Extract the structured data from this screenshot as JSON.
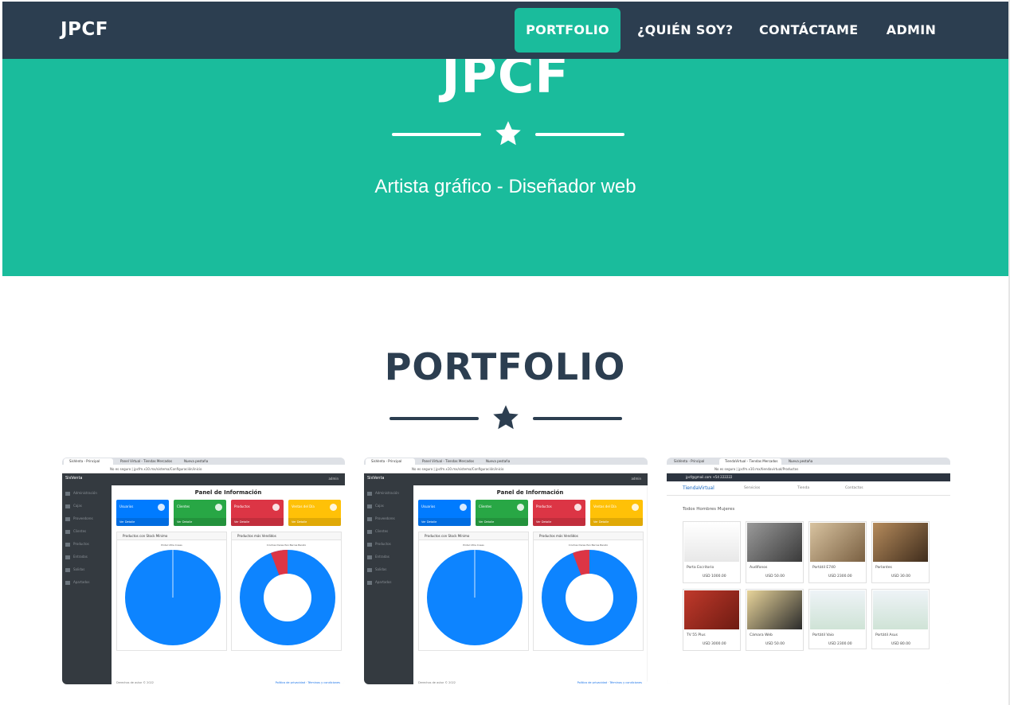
{
  "navbar": {
    "brand": "JPCF",
    "links": [
      {
        "label": "PORTFOLIO",
        "active": true
      },
      {
        "label": "¿QUIÉN SOY?",
        "active": false
      },
      {
        "label": "CONTÁCTAME",
        "active": false
      },
      {
        "label": "ADMIN",
        "active": false
      }
    ]
  },
  "hero": {
    "title": "JPCF",
    "subtitle": "Artista gráfico - Diseñador web"
  },
  "portfolio": {
    "title": "PORTFOLIO",
    "items": [
      {
        "type": "dashboard",
        "tabs": [
          "SisVenta - Principal",
          "Panel Virtual - Tiendas Mercados",
          "Nueva pestaña"
        ],
        "url": "No es seguro | jpcfm.x10.mx/sistema/Configuración/inicio",
        "app_name": "SisVenta",
        "user": "admin",
        "menu": [
          "Administración",
          "Cajas",
          "Proveedores",
          "Clientes",
          "Productos",
          "Entradas",
          "Salidas",
          "Apartados"
        ],
        "heading": "Panel de Información",
        "boxes": [
          {
            "label": "Usuarios",
            "footer": "Ver Detalle",
            "color": "#007bff"
          },
          {
            "label": "Clientes",
            "footer": "Ver Detalle",
            "color": "#28a745"
          },
          {
            "label": "Productos",
            "footer": "Ver Detalle",
            "color": "#dc3545"
          },
          {
            "label": "Ventas del Día",
            "footer": "Ver Detalle",
            "color": "#ffc107"
          }
        ],
        "panels": [
          {
            "title": "Productos con Stock Mínimo",
            "legend": "Pintal Ultra    Cosas"
          },
          {
            "title": "Productos más Vendidos",
            "legend": "Cinchas Dares    Pan Barras Barato"
          }
        ],
        "footer_left": "Derechos de autor © 2022",
        "footer_right": "Política de privacidad · Términos y condiciones"
      },
      {
        "type": "dashboard",
        "tabs": [
          "SisVenta - Principal",
          "Panel Virtual - Tiendas Mercados",
          "Nueva pestaña"
        ],
        "url": "No es seguro | jpcfm.x10.mx/sistema/Configuración/inicio",
        "app_name": "SisVenta",
        "user": "admin",
        "menu": [
          "Administración",
          "Cajas",
          "Proveedores",
          "Clientes",
          "Productos",
          "Entradas",
          "Salidas",
          "Apartados"
        ],
        "heading": "Panel de Información",
        "boxes": [
          {
            "label": "Usuarios",
            "footer": "Ver Detalle",
            "color": "#007bff"
          },
          {
            "label": "Clientes",
            "footer": "Ver Detalle",
            "color": "#28a745"
          },
          {
            "label": "Productos",
            "footer": "Ver Detalle",
            "color": "#dc3545"
          },
          {
            "label": "Ventas del Día",
            "footer": "Ver Detalle",
            "color": "#ffc107"
          }
        ],
        "panels": [
          {
            "title": "Productos con Stock Mínimo",
            "legend": "Pintal Ultra    Cosas"
          },
          {
            "title": "Productos más Vendidos",
            "legend": "Cinchas Dares    Pan Barras Barato"
          }
        ],
        "footer_left": "Derechos de autor © 2022",
        "footer_right": "Política de privacidad · Términos y condiciones"
      },
      {
        "type": "shop",
        "tabs": [
          "SisVenta - Principal",
          "TiendaVirtual - Tiendas Mercados",
          "Nueva pestaña"
        ],
        "url": "No es seguro | jpcfm.x10.mx/tiendavirtual/Productos",
        "topbar": "jpcf@gmail.com    +54 222222",
        "brand": "TiendaVirtual",
        "nav": [
          "Servicios",
          "Tienda",
          "Contactos"
        ],
        "filters": "Todos  Hombres  Mujeres",
        "products": [
          {
            "name": "Porta Escritorio",
            "price": "USD 1000.00"
          },
          {
            "name": "Audífonos",
            "price": "USD 50.00"
          },
          {
            "name": "Portátil E740",
            "price": "USD 2300.00"
          },
          {
            "name": "Parlantes",
            "price": "USD 30.00"
          },
          {
            "name": "TV 55 Plus",
            "price": "USD 3000.00"
          },
          {
            "name": "Cámara Web",
            "price": "USD 50.00"
          },
          {
            "name": "Portátil Vaio",
            "price": "USD 2300.00"
          },
          {
            "name": "Portátil Asus",
            "price": "USD 80.00"
          }
        ]
      }
    ]
  },
  "colors": {
    "primary": "#1abc9c",
    "navbar": "#2c3e50",
    "heading": "#2c3e50"
  },
  "icons": {
    "star": "star-icon"
  }
}
